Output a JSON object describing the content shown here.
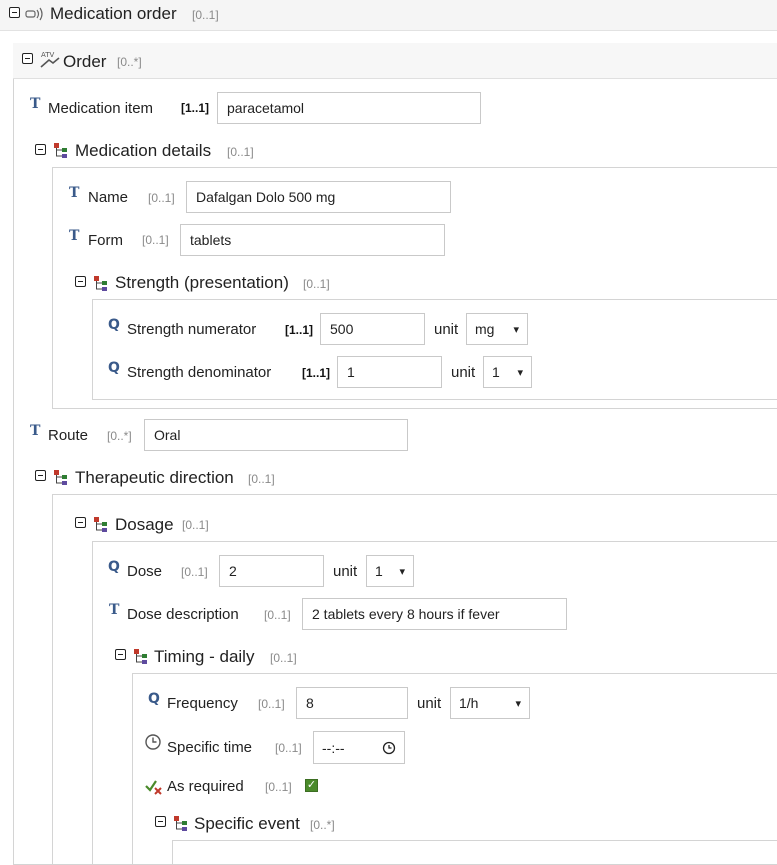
{
  "medication_order": {
    "title": "Medication order",
    "card": "[0..1]"
  },
  "order": {
    "title": "Order",
    "card": "[0..*]"
  },
  "medication_item": {
    "label": "Medication item",
    "card": "[1..1]",
    "value": "paracetamol"
  },
  "medication_details": {
    "title": "Medication details",
    "card": "[0..1]",
    "name": {
      "label": "Name",
      "card": "[0..1]",
      "value": "Dafalgan Dolo 500 mg"
    },
    "form": {
      "label": "Form",
      "card": "[0..1]",
      "value": "tablets"
    }
  },
  "strength": {
    "title": "Strength (presentation)",
    "card": "[0..1]",
    "numerator": {
      "label": "Strength numerator",
      "card": "[1..1]",
      "value": "500",
      "unit_label": "unit",
      "unit": "mg"
    },
    "denominator": {
      "label": "Strength denominator",
      "card": "[1..1]",
      "value": "1",
      "unit_label": "unit",
      "unit": "1"
    }
  },
  "route": {
    "label": "Route",
    "card": "[0..*]",
    "value": "Oral"
  },
  "therapeutic_direction": {
    "title": "Therapeutic direction",
    "card": "[0..1]"
  },
  "dosage": {
    "title": "Dosage",
    "card": "[0..1]",
    "dose": {
      "label": "Dose",
      "card": "[0..1]",
      "value": "2",
      "unit_label": "unit",
      "unit": "1"
    },
    "dose_description": {
      "label": "Dose description",
      "card": "[0..1]",
      "value": "2 tablets every 8 hours if fever"
    }
  },
  "timing": {
    "title": "Timing - daily",
    "card": "[0..1]",
    "frequency": {
      "label": "Frequency",
      "card": "[0..1]",
      "value": "8",
      "unit_label": "unit",
      "unit": "1/h"
    },
    "specific_time": {
      "label": "Specific time",
      "card": "[0..1]",
      "value": "--:--"
    },
    "as_required": {
      "label": "As required",
      "card": "[0..1]",
      "checked": true
    }
  },
  "specific_event": {
    "title": "Specific event",
    "card": "[0..*]"
  }
}
